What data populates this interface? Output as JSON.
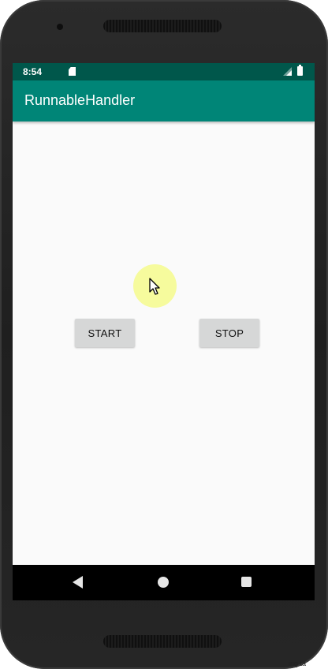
{
  "status_bar": {
    "time": "8:54",
    "icons": [
      "sd-card-icon",
      "signal-icon",
      "battery-icon"
    ],
    "background": "#00574b"
  },
  "app_bar": {
    "title": "RunnableHandler",
    "background": "#008577"
  },
  "buttons": {
    "start_label": "START",
    "stop_label": "STOP",
    "background": "#d6d7d7"
  },
  "nav_bar": {
    "icons": [
      "back-icon",
      "home-icon",
      "recents-icon"
    ]
  },
  "overlay": {
    "corner_text": "ing ta"
  }
}
